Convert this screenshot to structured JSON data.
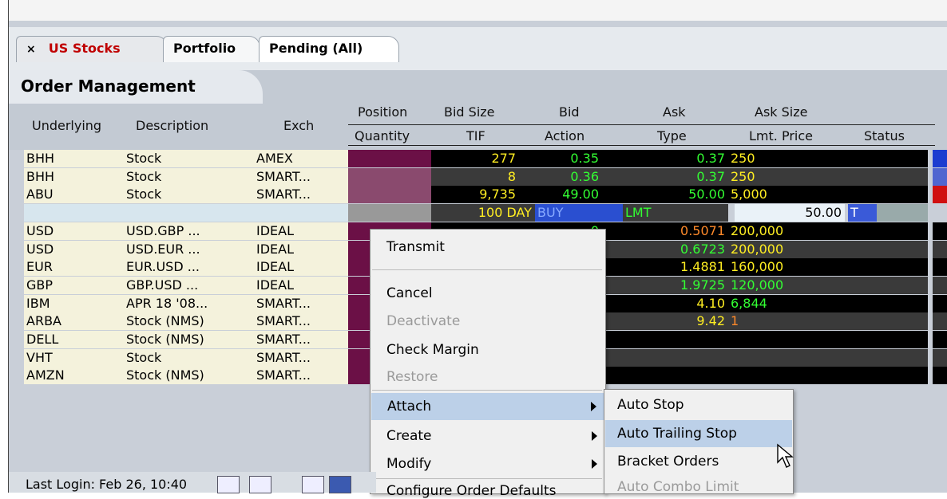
{
  "tabs": [
    {
      "label": "US Stocks",
      "close": "×"
    },
    {
      "label": "Portfolio"
    },
    {
      "label": "Pending (All)"
    }
  ],
  "panel_title": "Order Management",
  "columns": {
    "underlying": "Underlying",
    "description": "Description",
    "exch": "Exch",
    "position": "Position",
    "quantity": "Quantity",
    "bid_size": "Bid Size",
    "tif": "TIF",
    "bid": "Bid",
    "action": "Action",
    "ask": "Ask",
    "type": "Type",
    "ask_size": "Ask Size",
    "lmt_price": "Lmt. Price",
    "status": "Status"
  },
  "rows": [
    {
      "und": "BHH",
      "desc": "Stock",
      "exch": "AMEX",
      "bidsize": "277",
      "bid": "0.35",
      "ask": "0.37",
      "asksize": "250"
    },
    {
      "und": "BHH",
      "desc": "Stock",
      "exch": "SMART...",
      "bidsize": "8",
      "bid": "0.36",
      "ask": "0.37",
      "asksize": "250"
    },
    {
      "und": "ABU",
      "desc": "Stock",
      "exch": "SMART...",
      "bidsize": "9,735",
      "bid": "49.00",
      "ask": "50.00",
      "asksize": "5,000"
    },
    {
      "und": "",
      "desc": "",
      "exch": "",
      "bidsize": "100 DAY",
      "bid": "BUY",
      "ask": "LMT",
      "asksize": "50.00",
      "status": "T"
    },
    {
      "und": "USD",
      "desc": "USD.GBP ...",
      "exch": "IDEAL",
      "bidsize": "",
      "bid": "0",
      "ask": "0.5071",
      "asksize": "200,000"
    },
    {
      "und": "USD",
      "desc": "USD.EUR ...",
      "exch": "IDEAL",
      "bidsize": "",
      "bid": "0",
      "ask": "0.6723",
      "asksize": "200,000"
    },
    {
      "und": "EUR",
      "desc": "EUR.USD ...",
      "exch": "IDEAL",
      "bidsize": "",
      "bid": "2",
      "ask": "1.4881",
      "asksize": "160,000"
    },
    {
      "und": "GBP",
      "desc": "GBP.USD ...",
      "exch": "IDEAL",
      "bidsize": "",
      "bid": "3",
      "ask": "1.9725",
      "asksize": "120,000"
    },
    {
      "und": "IBM",
      "desc": "APR 18 '08...",
      "exch": "SMART...",
      "bidsize": "",
      "bid": "0",
      "ask": "4.10",
      "asksize": "6,844"
    },
    {
      "und": "ARBA",
      "desc": "Stock (NMS)",
      "exch": "SMART...",
      "bidsize": "",
      "bid": "1",
      "ask": "9.42",
      "asksize": "1"
    },
    {
      "und": "DELL",
      "desc": "Stock (NMS)",
      "exch": "SMART...",
      "bidsize": "",
      "bid": "",
      "ask": "",
      "asksize": ""
    },
    {
      "und": "VHT",
      "desc": "Stock",
      "exch": "SMART...",
      "bidsize": "",
      "bid": "",
      "ask": "",
      "asksize": ""
    },
    {
      "und": "AMZN",
      "desc": "Stock (NMS)",
      "exch": "SMART...",
      "bidsize": "",
      "bid": "",
      "ask": "",
      "asksize": ""
    }
  ],
  "context_menu": {
    "transmit": "Transmit",
    "cancel": "Cancel",
    "deactivate": "Deactivate",
    "check_margin": "Check Margin",
    "restore": "Restore",
    "attach": "Attach",
    "create": "Create",
    "modify": "Modify",
    "configure": "Configure Order Defaults"
  },
  "submenu": {
    "auto_stop": "Auto Stop",
    "auto_trailing_stop": "Auto Trailing Stop",
    "bracket_orders": "Bracket Orders",
    "auto_combo_limit": "Auto Combo Limit"
  },
  "status_bar": {
    "last_login": "Last Login: Feb 26, 10:40"
  },
  "colors": {
    "tab_active_text": "#c00000",
    "green_value": "#33ff33",
    "orange_value": "#ff8a2a",
    "yellow_value": "#ffee22",
    "menu_highlight": "#bcd0e8",
    "position_cell": "#6b1046"
  }
}
